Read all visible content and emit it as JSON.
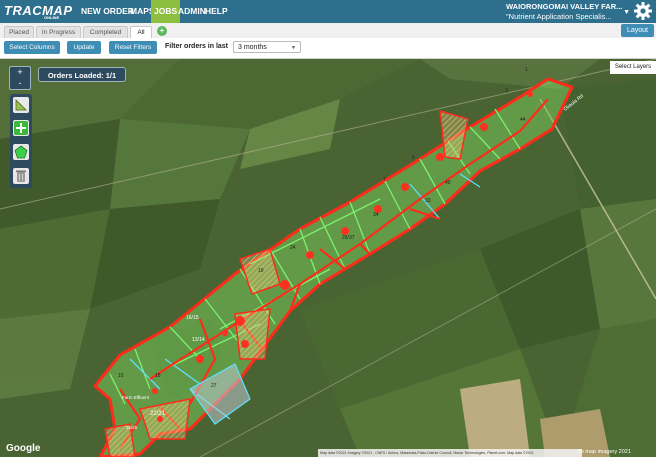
{
  "header": {
    "logo_text": "TRACMAP",
    "logo_sub": "ONLINE",
    "nav": [
      {
        "label": "NEW ORDER"
      },
      {
        "label": "MAPS"
      },
      {
        "label": "JOBS"
      },
      {
        "label": "ADMIN"
      },
      {
        "label": "HELP"
      }
    ],
    "farm_name": "WAIORONGOMAI VALLEY FAR...",
    "farm_sub": "\"Nutrient Application Specialis...",
    "menu_icon": "chevron-down-icon",
    "settings_icon": "gear-icon",
    "active_color": "#8cbf3f",
    "bar_color": "#2d6f8c"
  },
  "tabs": [
    {
      "label": "Placed"
    },
    {
      "label": "In Progress"
    },
    {
      "label": "Completed"
    },
    {
      "label": "All"
    }
  ],
  "add_tab_label": "+",
  "layout_label": "Layout",
  "toolbar": {
    "select_columns": "Select Columns",
    "update": "Update",
    "reset_filters": "Reset Filters",
    "filter_label": "Filter orders in last",
    "filter_value": "3 months"
  },
  "map": {
    "zoom_in": "+",
    "zoom_out": "-",
    "orders_loaded": "Orders Loaded: 1/1",
    "select_layers": "Select Layers",
    "google": "Google",
    "attribution": "Map data ©2021 Imagery ©2021 , CNES / Airbus, Matamata-Piako District Council, Maxar Technologies, Planet.com, Map data ©2021",
    "scale": "To map imagery 2021",
    "road_label": "Okauia Rd",
    "tools": [
      "ruler-icon",
      "add-icon",
      "pentagon-icon",
      "trash-icon"
    ],
    "paddock_labels": [
      {
        "id": "p1",
        "text": "1"
      },
      {
        "id": "p3",
        "text": "3"
      },
      {
        "id": "p44",
        "text": "44"
      },
      {
        "id": "p6",
        "text": "6"
      },
      {
        "id": "p7",
        "text": "7"
      },
      {
        "id": "p40",
        "text": "40"
      },
      {
        "id": "p33",
        "text": "33"
      },
      {
        "id": "p34",
        "text": "34"
      },
      {
        "id": "p2637",
        "text": "26/37"
      },
      {
        "id": "p24",
        "text": "24"
      },
      {
        "id": "p19",
        "text": "19"
      },
      {
        "id": "p1615",
        "text": "16/15"
      },
      {
        "id": "p1314",
        "text": "13/14"
      },
      {
        "id": "p15",
        "text": "15"
      },
      {
        "id": "p18",
        "text": "18"
      },
      {
        "id": "p27",
        "text": "27"
      },
      {
        "id": "p2221",
        "text": "22/21"
      },
      {
        "id": "p2625",
        "text": "26/25"
      },
      {
        "id": "pfarm",
        "text": "Farm Effluent"
      }
    ]
  }
}
